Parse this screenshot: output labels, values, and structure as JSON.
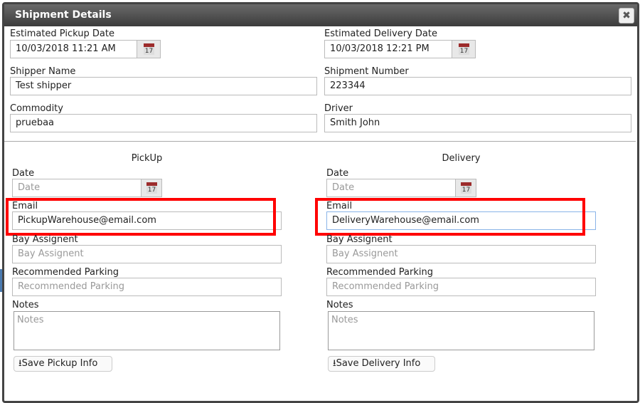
{
  "dialog": {
    "title": "Shipment Details",
    "close_icon": "close-icon"
  },
  "top": {
    "pickup_date": {
      "label": "Estimated Pickup Date",
      "value": "10/03/2018 11:21 AM"
    },
    "delivery_date": {
      "label": "Estimated Delivery Date",
      "value": "10/03/2018 12:21 PM"
    },
    "shipper": {
      "label": "Shipper Name",
      "value": "Test shipper"
    },
    "shipment_number": {
      "label": "Shipment Number",
      "value": "223344"
    },
    "commodity": {
      "label": "Commodity",
      "value": "pruebaa"
    },
    "driver": {
      "label": "Driver",
      "value": "Smith John"
    }
  },
  "calendar_day": "17",
  "pickup": {
    "heading": "PickUp",
    "date_label": "Date",
    "date_placeholder": "Date",
    "email_label": "Email",
    "email_value": "PickupWarehouse@email.com",
    "bay_label": "Bay Assignent",
    "bay_placeholder": "Bay Assignent",
    "parking_label": "Recommended Parking",
    "parking_placeholder": "Recommended Parking",
    "notes_label": "Notes",
    "notes_placeholder": "Notes",
    "save_label": "Save Pickup Info"
  },
  "delivery": {
    "heading": "Delivery",
    "date_label": "Date",
    "date_placeholder": "Date",
    "email_label": "Email",
    "email_value": "DeliveryWarehouse@email.com",
    "bay_label": "Bay Assignent",
    "bay_placeholder": "Bay Assignent",
    "parking_label": "Recommended Parking",
    "parking_placeholder": "Recommended Parking",
    "notes_label": "Notes",
    "notes_placeholder": "Notes",
    "save_label": "Save Delivery Info"
  },
  "highlight_color": "#ff0000"
}
